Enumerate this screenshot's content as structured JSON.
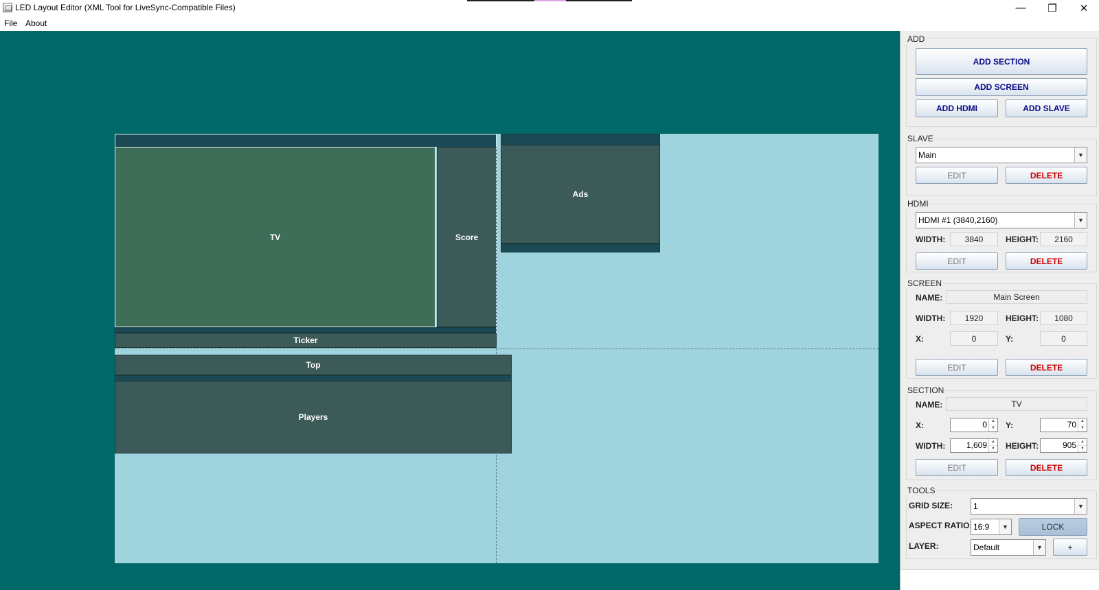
{
  "window": {
    "title": "LED Layout Editor (XML Tool for LiveSync-Compatible Files)",
    "minimize_glyph": "—",
    "restore_glyph": "❐",
    "close_glyph": "✕"
  },
  "menu": {
    "file": "File",
    "about": "About"
  },
  "colors": {
    "workspace": "#006868",
    "canvas": "#9fd3de",
    "block": "#3c5a58",
    "tv_block": "#3f6e58",
    "strip": "#1c4a54"
  },
  "canvas": {
    "blocks": {
      "tv": "TV",
      "score": "Score",
      "ads": "Ads",
      "ticker": "Ticker",
      "top": "Top",
      "players": "Players"
    }
  },
  "panel": {
    "add": {
      "title": "ADD",
      "add_section": "ADD SECTION",
      "add_screen": "ADD SCREEN",
      "add_hdmi": "ADD HDMI",
      "add_slave": "ADD SLAVE"
    },
    "slave": {
      "title": "SLAVE",
      "selected": "Main",
      "edit": "EDIT",
      "delete": "DELETE"
    },
    "hdmi": {
      "title": "HDMI",
      "selected": "HDMI #1 (3840,2160)",
      "width_label": "WIDTH:",
      "width": "3840",
      "height_label": "HEIGHT:",
      "height": "2160",
      "edit": "EDIT",
      "delete": "DELETE"
    },
    "screen": {
      "title": "SCREEN",
      "name_label": "NAME:",
      "name": "Main Screen",
      "width_label": "WIDTH:",
      "width": "1920",
      "height_label": "HEIGHT:",
      "height": "1080",
      "x_label": "X:",
      "x": "0",
      "y_label": "Y:",
      "y": "0",
      "edit": "EDIT",
      "delete": "DELETE"
    },
    "section": {
      "title": "SECTION",
      "name_label": "NAME:",
      "name": "TV",
      "x_label": "X:",
      "x": "0",
      "y_label": "Y:",
      "y": "70",
      "width_label": "WIDTH:",
      "width": "1,609",
      "height_label": "HEIGHT:",
      "height": "905",
      "edit": "EDIT",
      "delete": "DELETE"
    },
    "tools": {
      "title": "TOOLS",
      "grid_label": "GRID SIZE:",
      "grid": "1",
      "aspect_label": "ASPECT RATIO:",
      "aspect": "16:9",
      "lock": "LOCK",
      "layer_label": "LAYER:",
      "layer": "Default",
      "plus": "+"
    }
  }
}
